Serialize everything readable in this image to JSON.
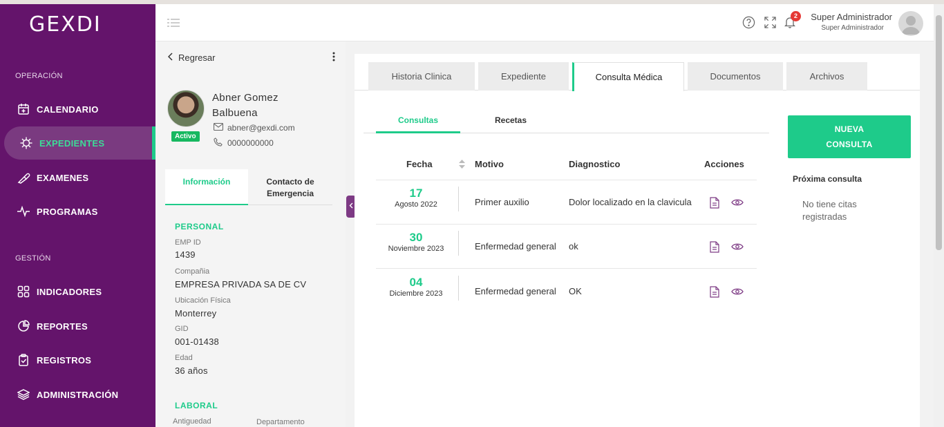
{
  "app": {
    "logo": "GEXDI"
  },
  "sidebar": {
    "sections": [
      {
        "label": "OPERACIÓN"
      },
      {
        "label": "GESTIÓN"
      }
    ],
    "items": [
      {
        "label": "CALENDARIO",
        "icon": "calendar-icon"
      },
      {
        "label": "EXPEDIENTES",
        "icon": "virus-icon",
        "active": true
      },
      {
        "label": "EXAMENES",
        "icon": "pipette-icon"
      },
      {
        "label": "PROGRAMAS",
        "icon": "pulse-icon"
      },
      {
        "label": "INDICADORES",
        "icon": "grid-icon"
      },
      {
        "label": "REPORTES",
        "icon": "pie-chart-icon"
      },
      {
        "label": "REGISTROS",
        "icon": "clipboard-icon"
      },
      {
        "label": "ADMINISTRACIÓN",
        "icon": "layers-icon"
      }
    ]
  },
  "header": {
    "notifications_count": "2",
    "user_name": "Super Administrador",
    "user_role": "Super Administrador"
  },
  "patient": {
    "back_label": "Regresar",
    "name": "Abner Gomez Balbuena",
    "status": "Activo",
    "email": "abner@gexdi.com",
    "phone": "0000000000",
    "tabs": [
      "Información",
      "Contacto de Emergencia"
    ],
    "personal_title": "PERSONAL",
    "fields": [
      {
        "label": "EMP ID",
        "value": "1439"
      },
      {
        "label": "Compañia",
        "value": "EMPRESA PRIVADA SA DE CV"
      },
      {
        "label": "Ubicación Física",
        "value": "Monterrey"
      },
      {
        "label": "GID",
        "value": "001-01438"
      },
      {
        "label": "Edad",
        "value": "36 años"
      }
    ],
    "laboral_title": "LABORAL",
    "laboral_fields": [
      "Antiguedad",
      "Departamento"
    ]
  },
  "main": {
    "tabs": [
      "Historia Clinica",
      "Expediente",
      "Consulta Médica",
      "Documentos",
      "Archivos"
    ],
    "active_tab": "Consulta Médica",
    "sub_tabs": [
      "Consultas",
      "Recetas"
    ],
    "table": {
      "headers": [
        "Fecha",
        "Motivo",
        "Diagnostico",
        "Acciones"
      ],
      "rows": [
        {
          "day": "17",
          "month": "Agosto 2022",
          "motivo": "Primer auxilio",
          "diagnostico": "Dolor localizado en la clavicula"
        },
        {
          "day": "30",
          "month": "Noviembre 2023",
          "motivo": "Enfermedad general",
          "diagnostico": "ok"
        },
        {
          "day": "04",
          "month": "Diciembre 2023",
          "motivo": "Enfermedad general",
          "diagnostico": "OK"
        }
      ]
    },
    "new_button": {
      "line1": "NUEVA",
      "line2": "CONSULTA"
    },
    "next_title": "Próxima consulta",
    "next_empty": "No tiene citas registradas"
  },
  "colors": {
    "sidebar": "#64146b",
    "accent": "#1ecb8a",
    "badge": "#e53935"
  }
}
